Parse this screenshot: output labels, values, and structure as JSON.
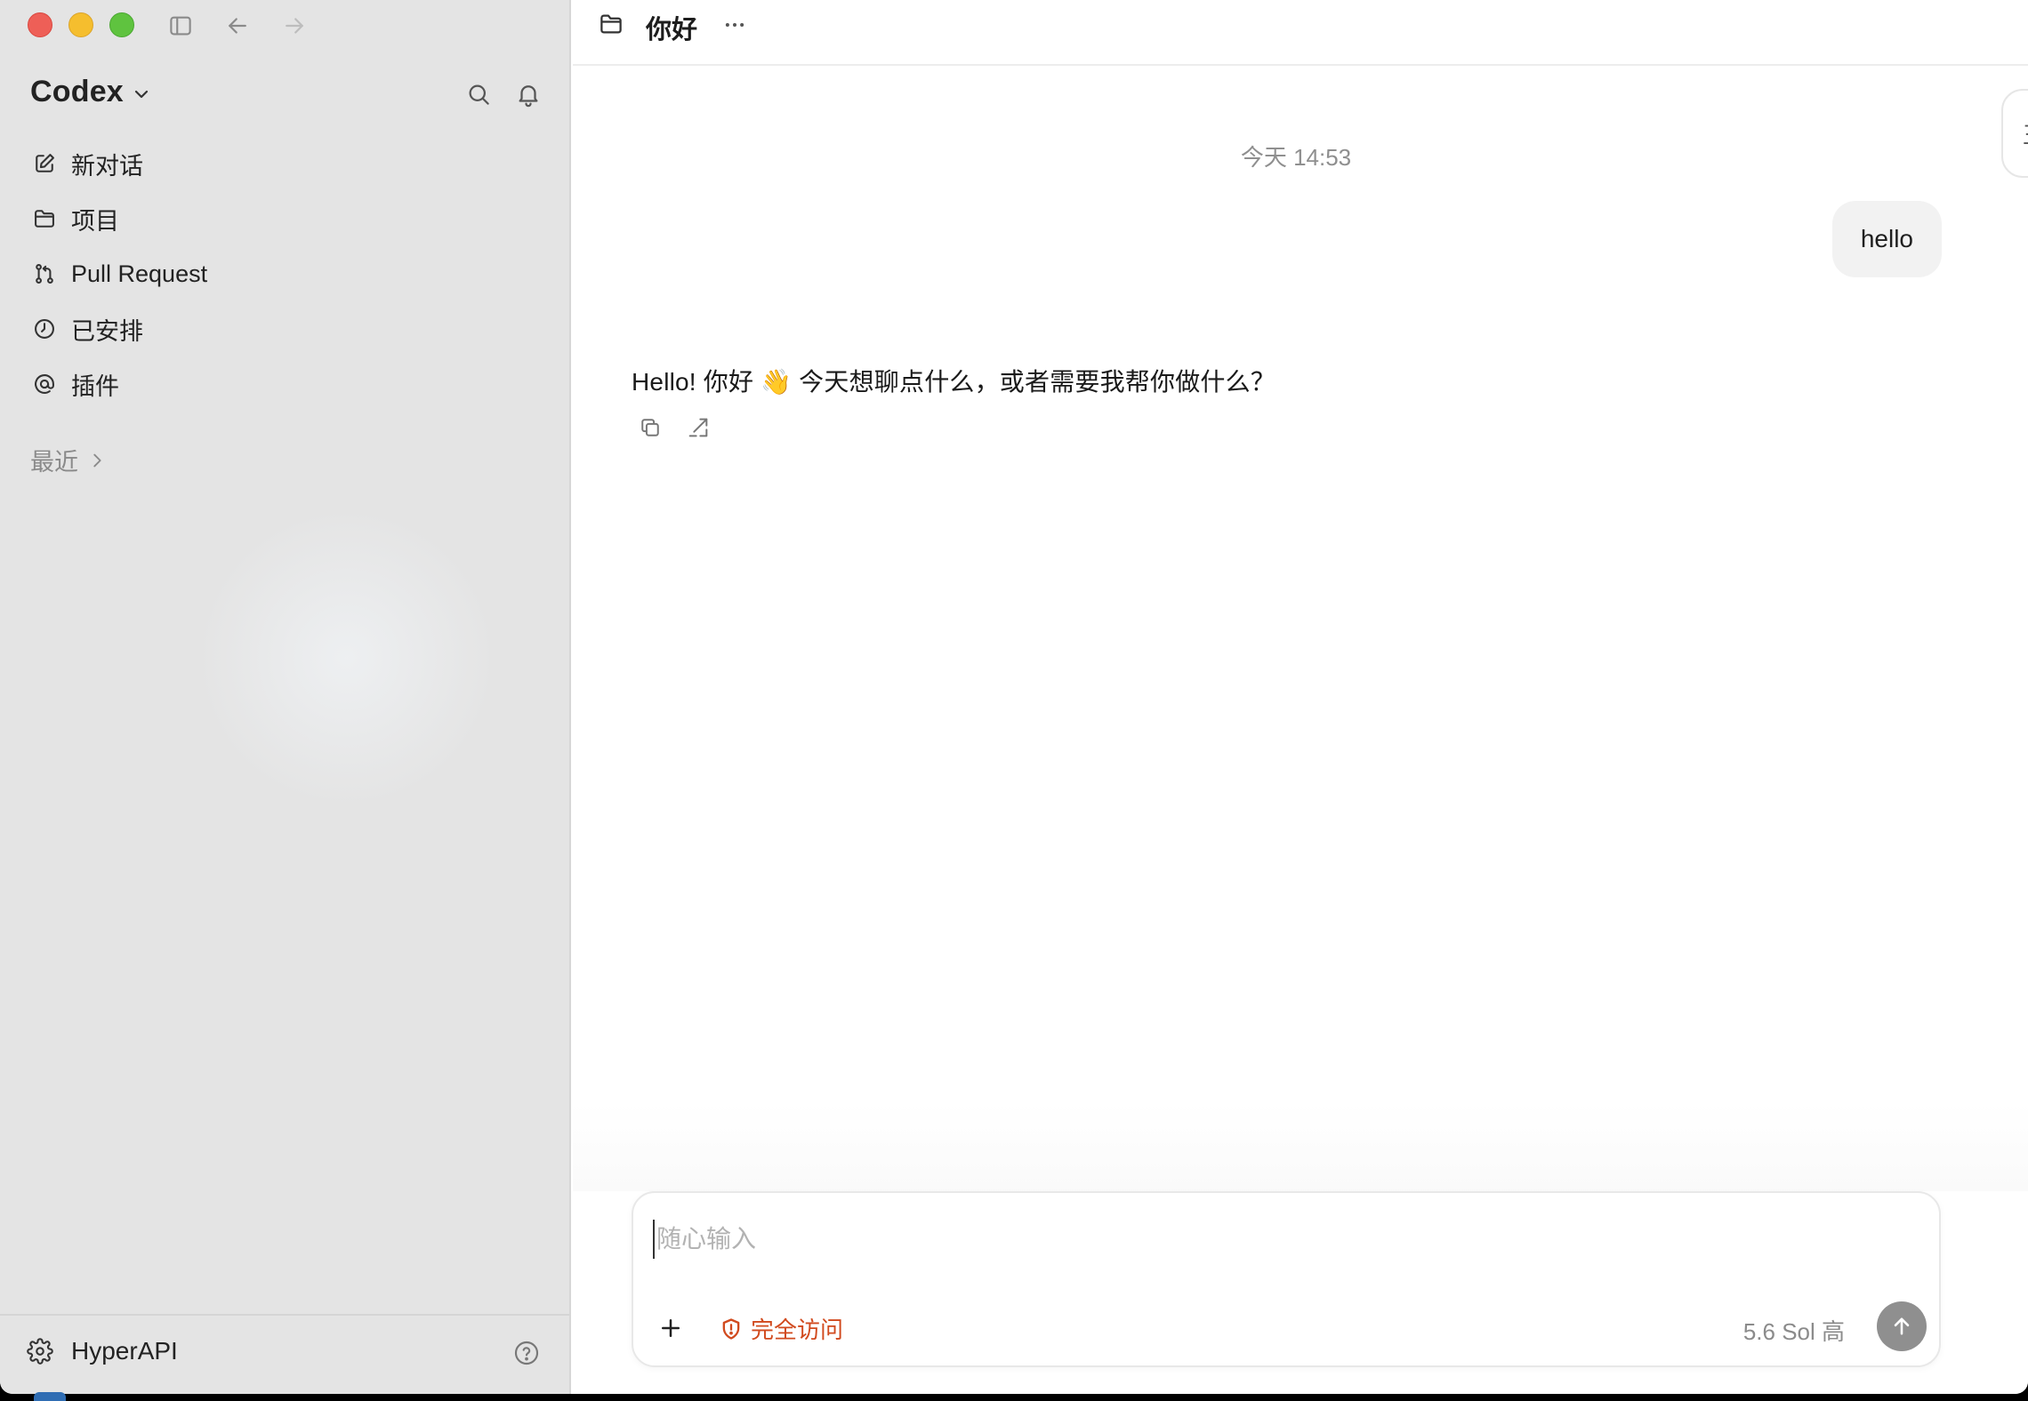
{
  "app": {
    "name": "Codex"
  },
  "sidebar": {
    "nav": [
      {
        "label": "新对话",
        "icon": "edit-icon"
      },
      {
        "label": "项目",
        "icon": "folder-icon"
      },
      {
        "label": "Pull Request",
        "icon": "git-pull-request-icon"
      },
      {
        "label": "已安排",
        "icon": "clock-icon"
      },
      {
        "label": "插件",
        "icon": "at-sign-icon"
      }
    ],
    "recent_label": "最近",
    "footer": {
      "settings_label": "HyperAPI"
    }
  },
  "main": {
    "title": "你好",
    "edge_tab_glyph": "王",
    "timestamp": "今天 14:53",
    "user_message": "hello",
    "assistant_message": "Hello! 你好 👋 今天想聊点什么，或者需要我帮你做什么？"
  },
  "composer": {
    "placeholder": "随心输入",
    "value": "",
    "access_label": "完全访问",
    "model_label": "5.6 Sol  高"
  },
  "colors": {
    "sidebar_bg": "#e4e4e4",
    "accent_warning": "#d14a1e",
    "send_button": "#8f8f8f",
    "traffic_red": "#ee5f57",
    "traffic_yellow": "#f5be2e",
    "traffic_green": "#5fc33f"
  }
}
